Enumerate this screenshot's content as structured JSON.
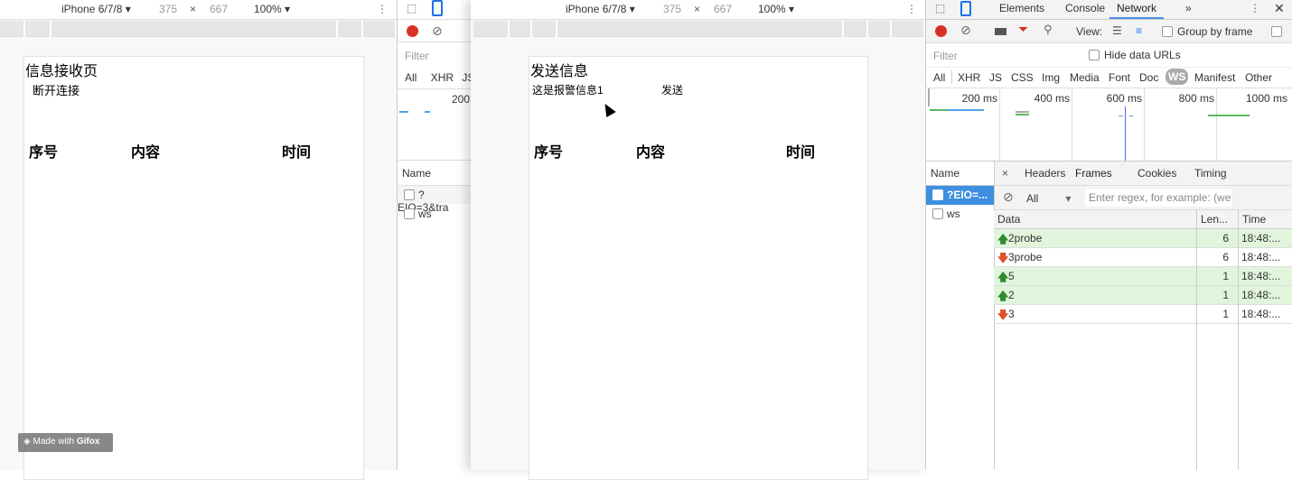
{
  "device_toolbar": {
    "device": "iPhone 6/7/8",
    "width": "375",
    "times": "×",
    "height": "667",
    "zoom": "100%"
  },
  "receiver_page": {
    "title": "信息接收页",
    "disconnect_label": "断开连接",
    "columns": [
      "序号",
      "内容",
      "时间"
    ]
  },
  "sender_page": {
    "title": "发送信息",
    "message": "这是报警信息1",
    "send_label": "发送",
    "columns": [
      "序号",
      "内容",
      "时间"
    ]
  },
  "devtools_left": {
    "filter_placeholder": "Filter",
    "types": [
      "All",
      "XHR",
      "JS"
    ],
    "tick": "200",
    "name_header": "Name",
    "requests": [
      "?EIO=3&tra",
      "ws"
    ]
  },
  "devtools": {
    "tabs": [
      "Elements",
      "Console",
      "Network"
    ],
    "more": "»",
    "active_tab": "Network",
    "view_label": "View:",
    "group_by_frame": "Group by frame",
    "filter_placeholder": "Filter",
    "hide_data_urls": "Hide data URLs",
    "types": [
      "All",
      "XHR",
      "JS",
      "CSS",
      "Img",
      "Media",
      "Font",
      "Doc",
      "WS",
      "Manifest",
      "Other"
    ],
    "active_type": "WS",
    "ticks": [
      "200 ms",
      "400 ms",
      "600 ms",
      "800 ms",
      "1000 ms"
    ],
    "name_header": "Name",
    "requests": [
      "?EIO=...",
      "ws"
    ],
    "detail_tabs": [
      "Headers",
      "Frames",
      "Cookies",
      "Timing"
    ],
    "active_detail_tab": "Frames",
    "frames_filter_select": "All",
    "frames_filter_placeholder": "Enter regex, for example: (we",
    "frame_columns": [
      "Data",
      "Len...",
      "Time"
    ],
    "frames": [
      {
        "dir": "up",
        "data": "2probe",
        "length": "6",
        "time": "18:48:..."
      },
      {
        "dir": "down",
        "data": "3probe",
        "length": "6",
        "time": "18:48:..."
      },
      {
        "dir": "up",
        "data": "5",
        "length": "1",
        "time": "18:48:..."
      },
      {
        "dir": "up",
        "data": "2",
        "length": "1",
        "time": "18:48:..."
      },
      {
        "dir": "down",
        "data": "3",
        "length": "1",
        "time": "18:48:..."
      }
    ],
    "colors": {
      "record": "#d93025",
      "active": "#1a73e8",
      "up": "#2e8b2e",
      "down": "#e0502a",
      "up_row": "#e1f5dc"
    }
  },
  "watermark": {
    "text": "Made with",
    "brand": "Gifox"
  }
}
